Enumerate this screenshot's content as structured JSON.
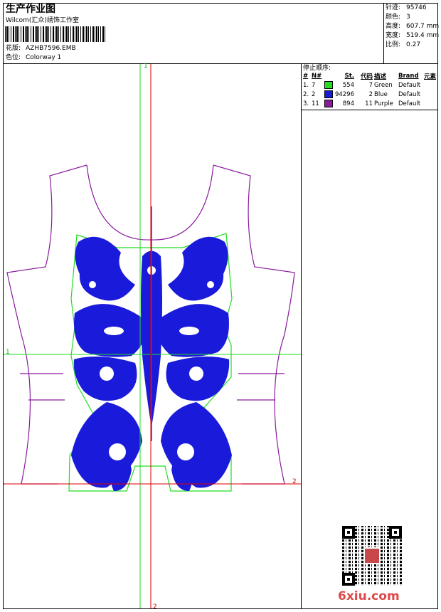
{
  "header": {
    "title": "生产作业图",
    "company": "Wilcom(汇众)绣饰工作室",
    "design_label": "花版:",
    "design_file": "AZHB7596.EMB",
    "colorway_label": "色位:",
    "colorway": "Colorway 1"
  },
  "stats": [
    {
      "label": "针迹:",
      "value": "95746"
    },
    {
      "label": "颜色:",
      "value": "3"
    },
    {
      "label": "高度:",
      "value": "607.7 mm"
    },
    {
      "label": "宽度:",
      "value": "519.4 mm"
    },
    {
      "label": "比例:",
      "value": "0.27"
    }
  ],
  "stop_sequence": {
    "title": "停止顺序:",
    "columns": [
      "#",
      "N#",
      "",
      "St.",
      "代码",
      "描述",
      "Brand",
      "元素"
    ],
    "rows": [
      {
        "index": "1.",
        "needle": "7",
        "color": "#22dd22",
        "stitches": "554",
        "code": "7",
        "desc": "Green",
        "brand": "Default"
      },
      {
        "index": "2.",
        "needle": "2",
        "color": "#1a1adb",
        "stitches": "94296",
        "code": "2",
        "desc": "Blue",
        "brand": "Default"
      },
      {
        "index": "3.",
        "needle": "11",
        "color": "#8a1a9e",
        "stitches": "894",
        "code": "11",
        "desc": "Purple",
        "brand": "Default"
      }
    ]
  },
  "axes": {
    "v_top": "1",
    "v_bottom": "2",
    "h_left": "1",
    "h_right": "2"
  },
  "colors": {
    "outline": "#8a1a9e",
    "fill": "#1a1adb",
    "green": "#22dd22",
    "red": "#dd0000"
  },
  "watermark": "6xiu.com"
}
